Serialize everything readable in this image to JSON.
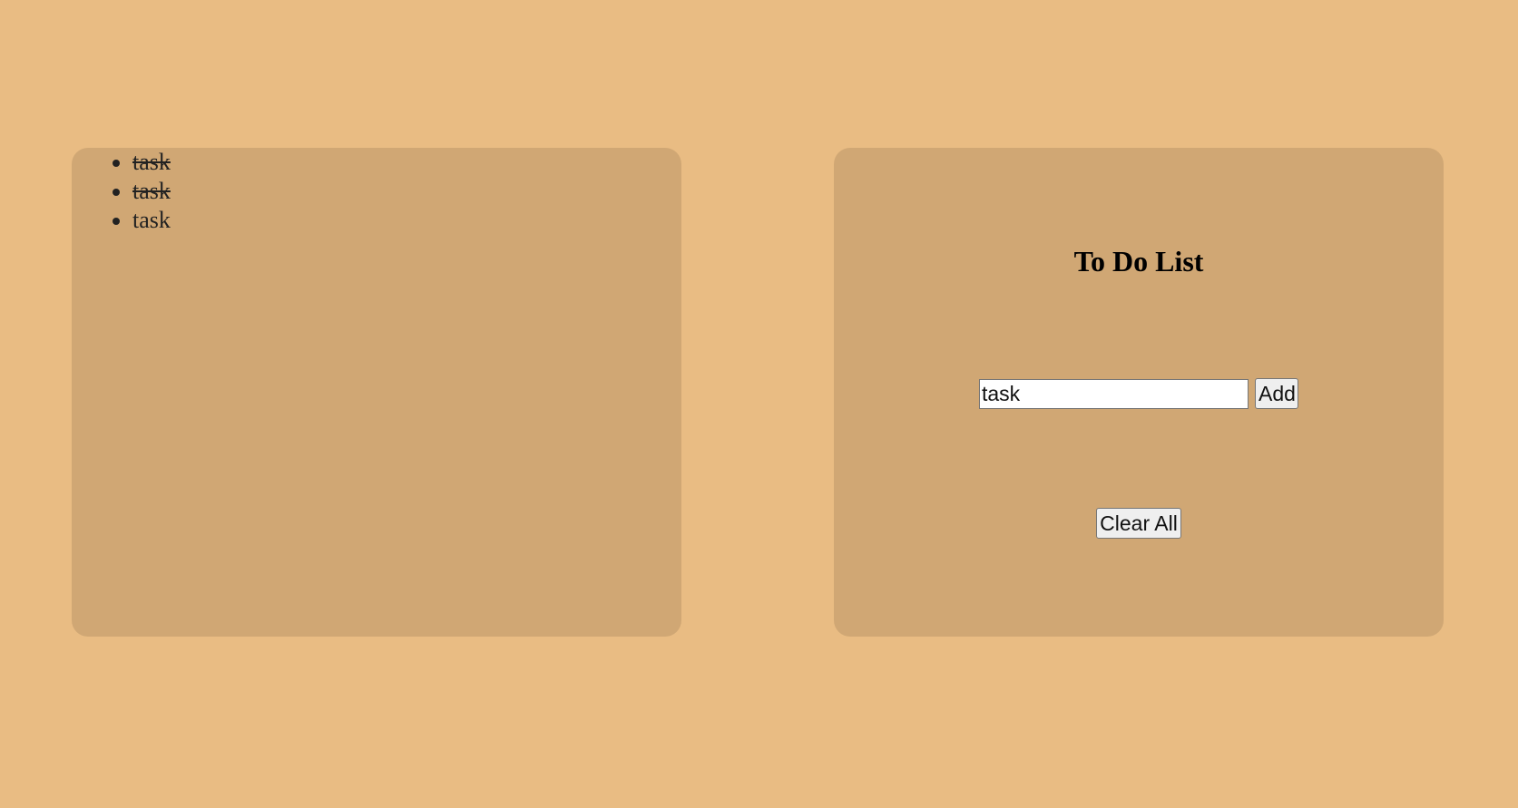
{
  "list": {
    "items": [
      {
        "label": "task",
        "done": true
      },
      {
        "label": "task",
        "done": true
      },
      {
        "label": "task",
        "done": false
      }
    ]
  },
  "form": {
    "title": "To Do List",
    "input_value": "task",
    "add_label": "Add",
    "clear_label": "Clear All"
  },
  "colors": {
    "background": "#e9bc83",
    "panel": "#d0a774"
  }
}
